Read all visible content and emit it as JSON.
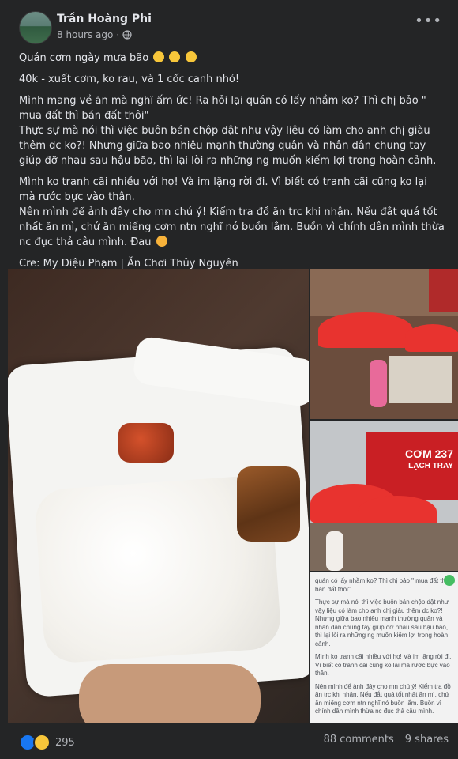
{
  "post": {
    "author": "Trần Hoàng Phi",
    "time": "8 hours ago",
    "privacy_icon": "globe-icon",
    "menu_icon": "more-options-icon",
    "more_label": "•••"
  },
  "content": {
    "line1": "Quán cơm ngày mưa bão",
    "line2": "40k - xuất cơm, ko rau, và 1 cốc canh nhỏ!",
    "para1a": "Mình mang về ăn mà nghĩ ấm ức! Ra hỏi lại quán có lấy nhầm ko? Thì chị bảo \" mua đất thì bán đất thôi\"",
    "para1b": "Thực sự mà nói thì việc buôn bán chộp dật như vậy liệu có làm cho anh chị giàu thêm dc ko?! Nhưng giữa bao nhiêu mạnh thường quân và nhân dân chung tay giúp đỡ nhau sau hậu bão, thì lại lòi ra những ng muốn kiếm lợi trong hoàn cảnh.",
    "para2a": "Mình ko tranh cãi nhiều với họ! Và im lặng rời đi. Vì biết có tranh cãi cũng ko lại mà rước bực vào thân.",
    "para2b": "Nên mình để ảnh đây cho mn chú ý! Kiểm tra đồ ăn trc khi nhận. Nếu đắt quá tốt nhất ăn mì, chứ ăn miếng cơm ntn nghĩ nó buồn lắm. Buồn vì chính dân mình thừa nc đục thả câu mình. Đau",
    "credit": "Cre: My Diệu Phạm | Ăn Chơi Thủy Nguyên"
  },
  "photos": {
    "sign_line1": "CƠM 237",
    "sign_line2": "LẠCH TRAY",
    "shot_lines": [
      "quán có lấy nhầm ko? Thì chị bảo \" mua đất thì bán đất thôi\"",
      "Thực sự mà nói thì việc buôn bán chộp dật như vậy liệu có làm cho anh chị giàu thêm dc ko?! Nhưng giữa bao nhiêu mạnh thường quân và nhân dân chung tay giúp đỡ nhau sau hậu bão, thì lại lòi ra những ng muốn kiếm lợi trong hoàn cảnh.",
      "Mình ko tranh cãi nhiều với họ! Và im lặng rời đi. Vì biết có tranh cãi cũng ko lại mà rước bực vào thân.",
      "Nên mình để ảnh đây cho mn chú ý! Kiểm tra đồ ăn trc khi nhận. Nếu đắt quá tốt nhất ăn mì, chứ ăn miếng cơm ntn nghĩ nó buồn lắm. Buồn vì chính dân mình thừa nc đục thả câu mình."
    ]
  },
  "footer": {
    "reaction_count": "295",
    "comments": "88 comments",
    "shares": "9 shares"
  },
  "colors": {
    "background": "#242526",
    "text": "#e4e6eb",
    "secondary": "#b0b3b8",
    "like_blue": "#1877f2"
  }
}
